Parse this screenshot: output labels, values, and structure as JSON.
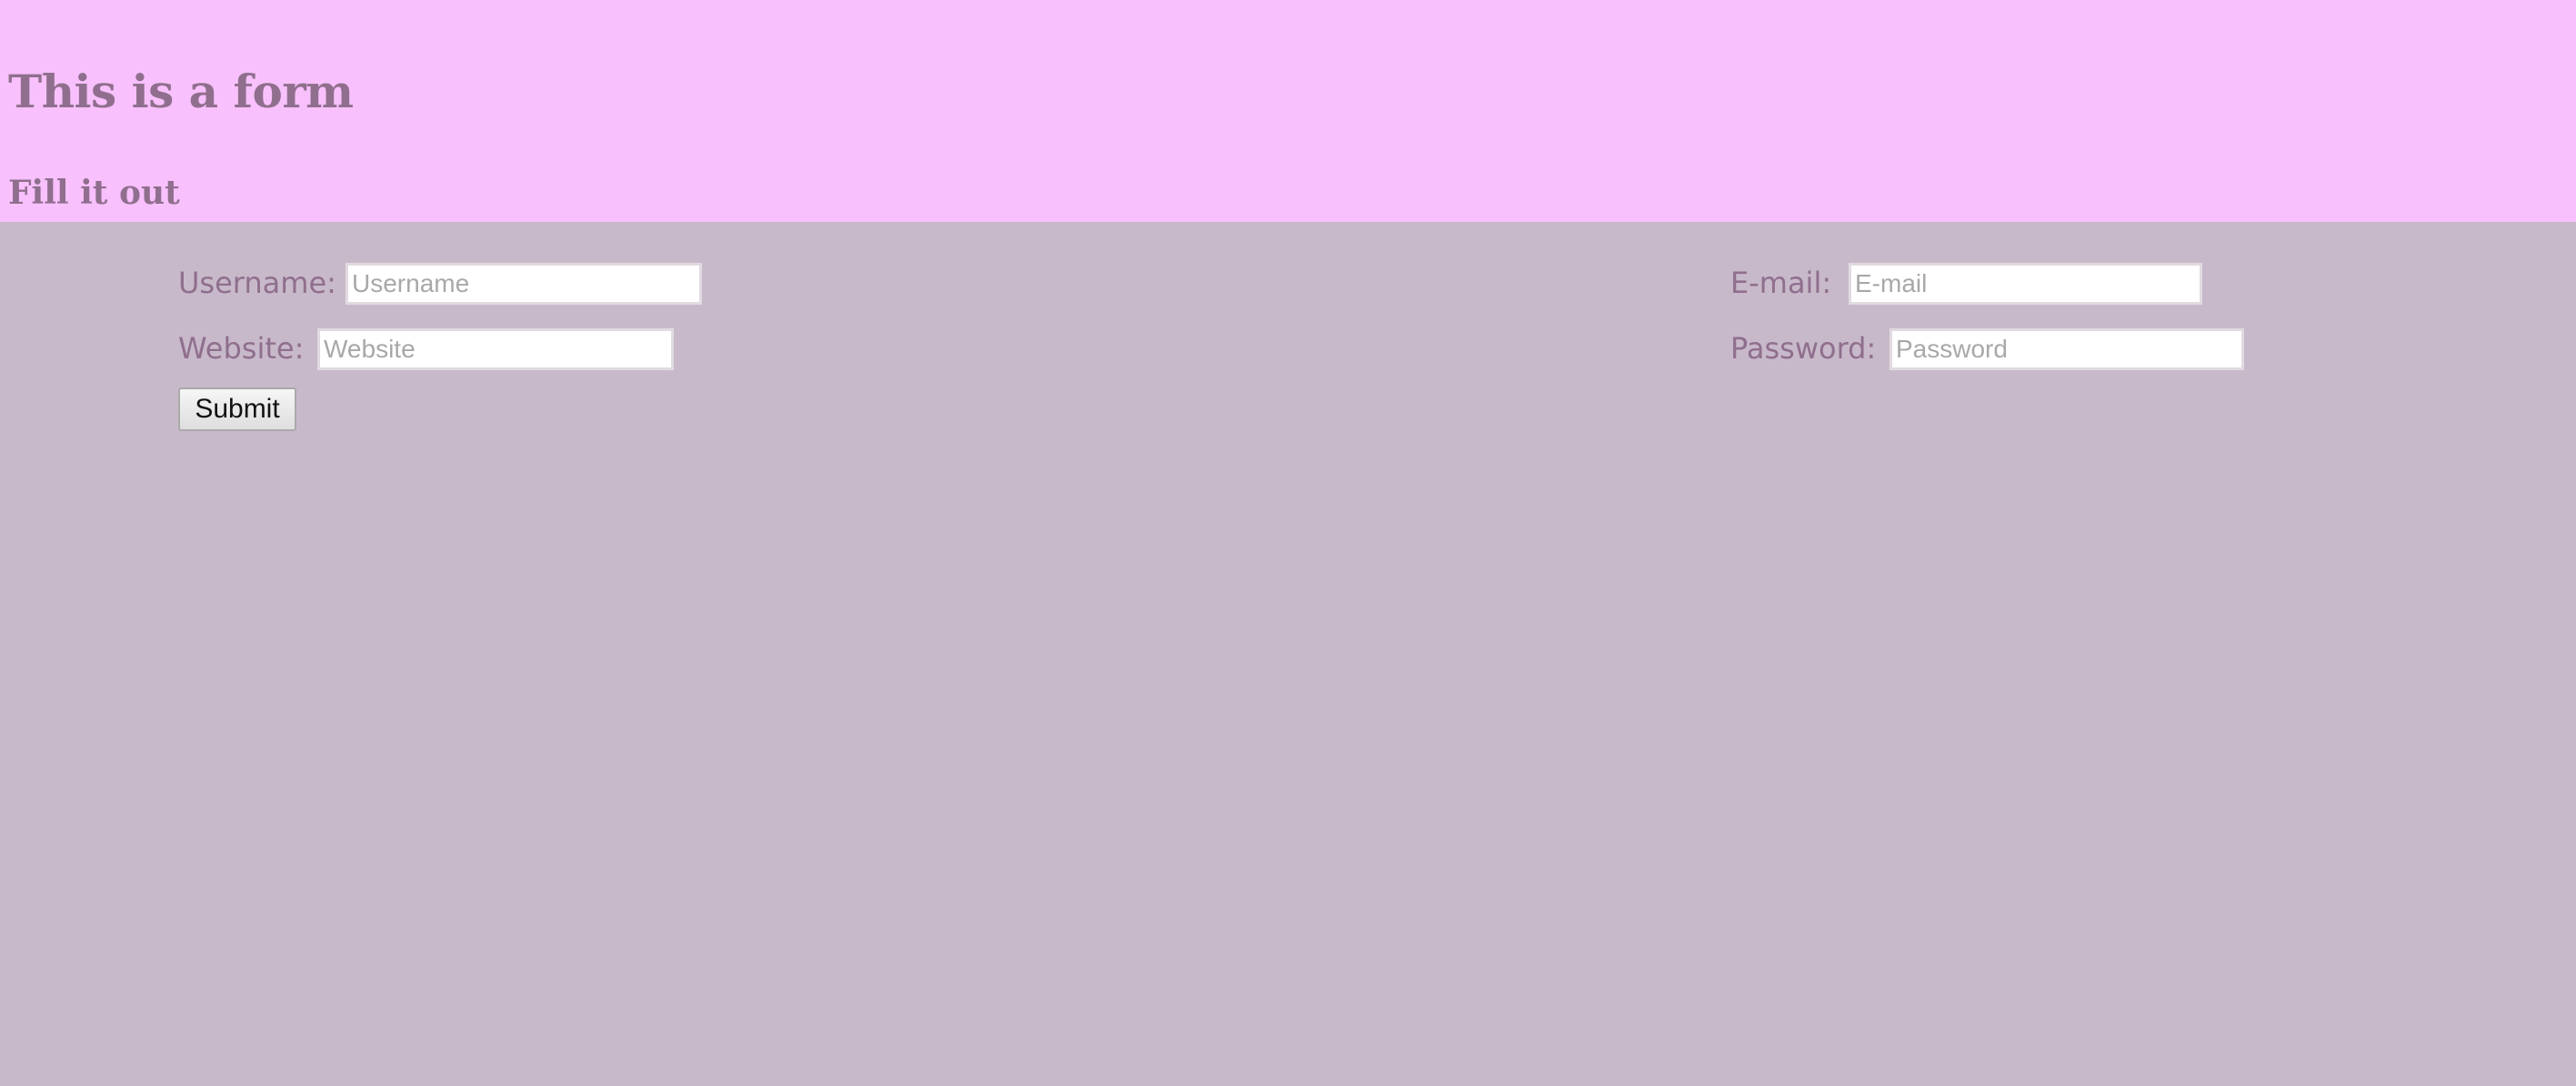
{
  "header": {
    "title": "This is a form",
    "subtitle": "Fill it out"
  },
  "form": {
    "username": {
      "label": "Username:",
      "placeholder": "Username",
      "value": ""
    },
    "website": {
      "label": "Website:",
      "placeholder": "Website",
      "value": ""
    },
    "email": {
      "label": "E-mail:",
      "placeholder": "E-mail",
      "value": ""
    },
    "password": {
      "label": "Password:",
      "placeholder": "Password",
      "value": ""
    },
    "submit_label": "Submit"
  },
  "colors": {
    "header_background": "#f8c0fc",
    "page_background": "#c8b9ca",
    "text": "#8f6f8d"
  }
}
